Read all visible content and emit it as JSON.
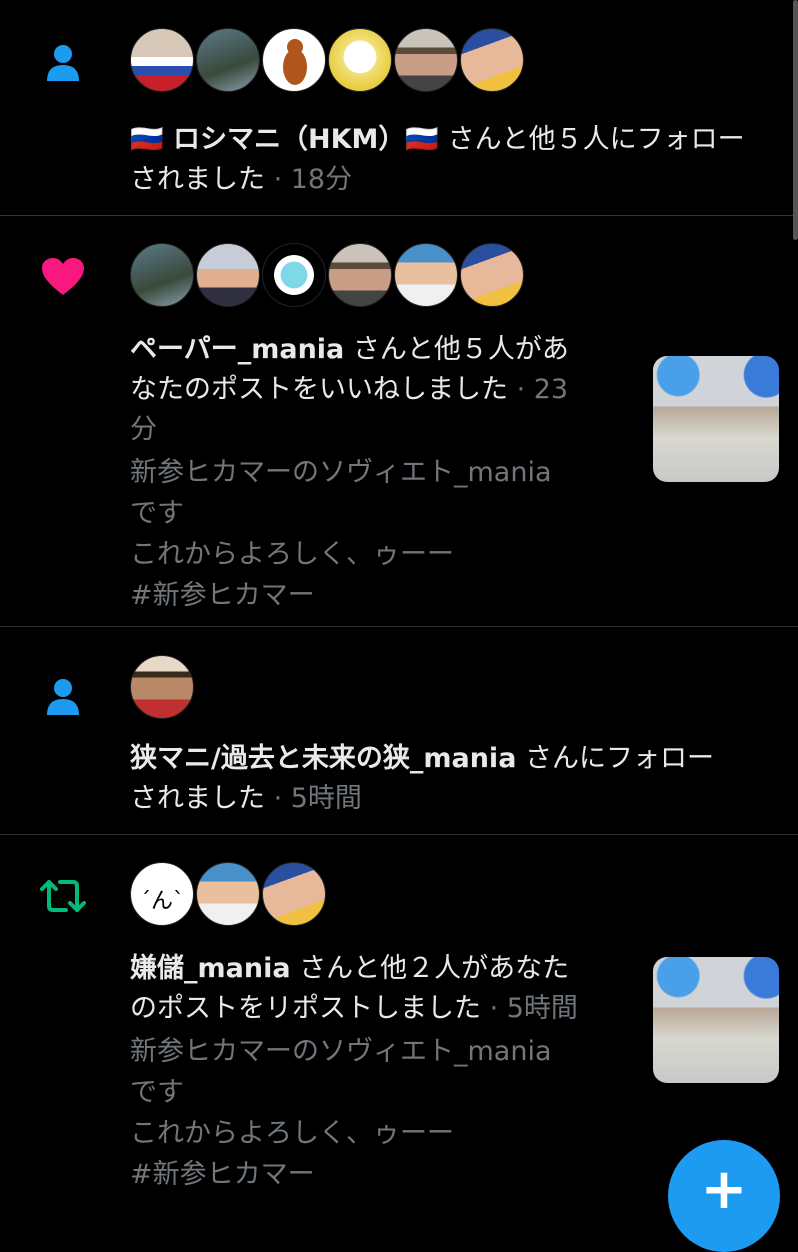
{
  "notifications": [
    {
      "type_icon": "person-icon",
      "icon_color": "#1d9bf0",
      "avatars": [
        "flag-avatar",
        "person-avatar",
        "monkey-avatar",
        "anime-avatar",
        "sunglasses-avatar",
        "twitter-avatar"
      ],
      "text_bold": "🇷🇺 ロシマニ（HKM）🇷🇺",
      "text_rest": "さんと他５人にフォロー",
      "text_rest2": "されました",
      "time": "· 18分"
    },
    {
      "type_icon": "heart-icon",
      "icon_color": "#f91880",
      "avatars": [
        "person-avatar",
        "person-avatar",
        "anime-avatar",
        "sunglasses-avatar",
        "headphones-avatar",
        "twitter-avatar"
      ],
      "text_bold": "ペーパー_mania",
      "text_rest": "さんと他５人があ",
      "text_rest2": "なたのポストをいいねしました",
      "time": "· 23",
      "time2": "分",
      "preview": "新参ヒカマーのソヴィエト_mania\nです\nこれからよろしく、ゥーー\n#新参ヒカマー"
    },
    {
      "type_icon": "person-icon",
      "icon_color": "#1d9bf0",
      "avatars": [
        "sunglasses-avatar"
      ],
      "text_bold": "狭マニ/過去と未来の狭_mania",
      "text_rest": "さんにフォロー",
      "text_rest2": "されました",
      "time": "· 5時間"
    },
    {
      "type_icon": "repost-icon",
      "icon_color": "#00ba7c",
      "avatars": [
        "emoticon-avatar",
        "headphones-avatar",
        "twitter-avatar"
      ],
      "avatar_text": "´ん`",
      "text_bold": "嫌儲_mania",
      "text_rest": "さんと他２人があなた",
      "text_rest2": "のポストをリポストしました",
      "time": "· 5時間",
      "preview": "新参ヒカマーのソヴィエト_mania\nです\nこれからよろしく、ゥーー\n#新参ヒカマー"
    }
  ],
  "fab": {
    "label": "+"
  }
}
